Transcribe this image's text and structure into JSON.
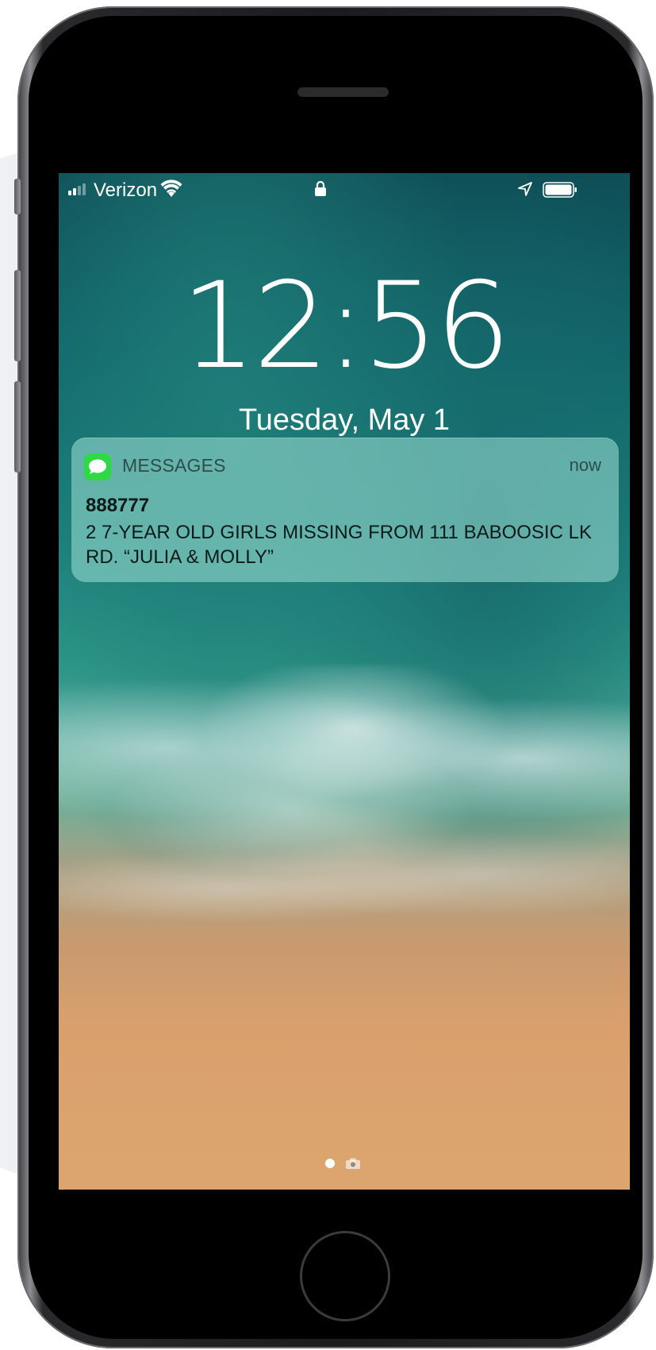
{
  "status_bar": {
    "carrier": "Verizon",
    "icons": [
      "signal-icon",
      "wifi-icon",
      "lock-icon",
      "location-icon",
      "battery-icon"
    ]
  },
  "lock_screen": {
    "time": "12:56",
    "date": "Tuesday, May 1"
  },
  "notification": {
    "app_name": "MESSAGES",
    "app_icon": "messages-icon",
    "app_icon_color": "#2fd845",
    "timestamp": "now",
    "sender": "888777",
    "body": "2 7-YEAR OLD GIRLS MISSING FROM 111 BABOOSIC LK RD. “JULIA & MOLLY”"
  },
  "page_indicator": {
    "icons": [
      "page-dot",
      "camera-icon"
    ]
  }
}
